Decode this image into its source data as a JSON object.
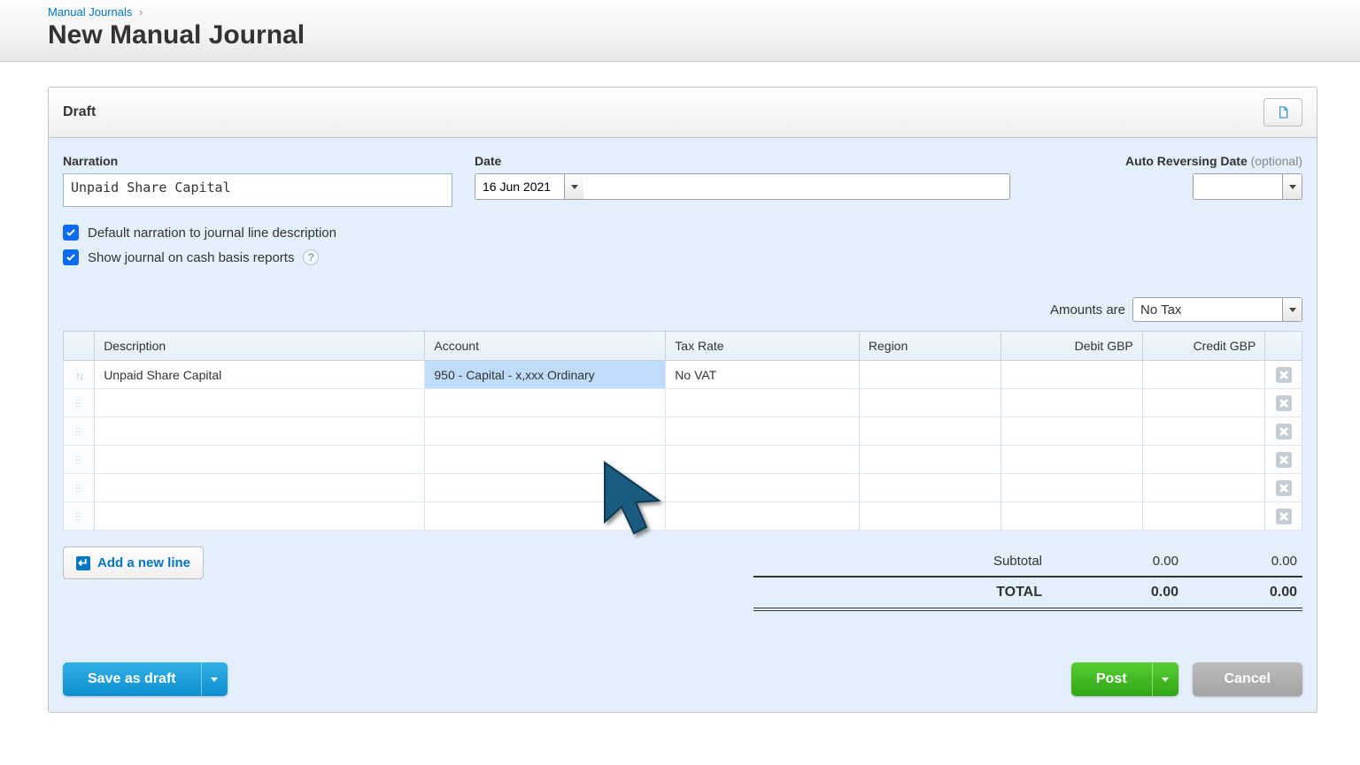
{
  "breadcrumb": {
    "parent": "Manual Journals",
    "sep": "›"
  },
  "page_title": "New Manual Journal",
  "panel": {
    "status": "Draft"
  },
  "form": {
    "narration_label": "Narration",
    "narration_value": "Unpaid Share Capital",
    "date_label": "Date",
    "date_value": "16 Jun 2021",
    "rev_label": "Auto Reversing Date",
    "rev_optional": "(optional)",
    "rev_value": "",
    "chk1_label": "Default narration to journal line description",
    "chk2_label": "Show journal on cash basis reports",
    "amounts_label": "Amounts are",
    "amounts_value": "No Tax"
  },
  "table": {
    "headers": {
      "description": "Description",
      "account": "Account",
      "tax": "Tax Rate",
      "region": "Region",
      "debit": "Debit GBP",
      "credit": "Credit GBP"
    },
    "rows": [
      {
        "description": "Unpaid Share Capital",
        "account": "950 - Capital - x,xxx Ordinary",
        "tax": "No VAT",
        "region": "",
        "debit": "",
        "credit": ""
      },
      {
        "description": "",
        "account": "",
        "tax": "",
        "region": "",
        "debit": "",
        "credit": ""
      },
      {
        "description": "",
        "account": "",
        "tax": "",
        "region": "",
        "debit": "",
        "credit": ""
      },
      {
        "description": "",
        "account": "",
        "tax": "",
        "region": "",
        "debit": "",
        "credit": ""
      },
      {
        "description": "",
        "account": "",
        "tax": "",
        "region": "",
        "debit": "",
        "credit": ""
      },
      {
        "description": "",
        "account": "",
        "tax": "",
        "region": "",
        "debit": "",
        "credit": ""
      }
    ]
  },
  "add_line_label": "Add a new line",
  "totals": {
    "subtotal_label": "Subtotal",
    "subtotal_debit": "0.00",
    "subtotal_credit": "0.00",
    "total_label": "TOTAL",
    "total_debit": "0.00",
    "total_credit": "0.00"
  },
  "actions": {
    "save_draft": "Save as draft",
    "post": "Post",
    "cancel": "Cancel"
  }
}
